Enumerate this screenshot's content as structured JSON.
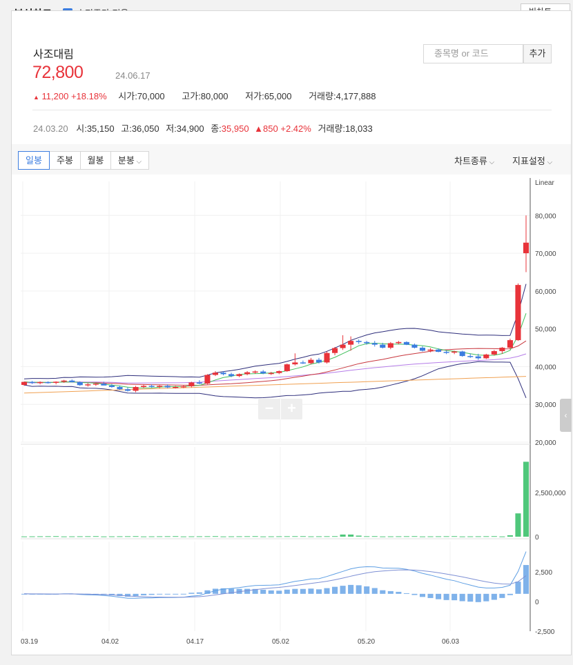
{
  "header": {
    "title": "분석차트",
    "adjusted_label": "수정주가 적용",
    "adjusted_checked": true,
    "big_chart_label": "빅차트"
  },
  "stock": {
    "name": "사조대림",
    "price": "72,800",
    "date": "24.06.17",
    "change": "11,200",
    "change_pct": "+18.18%",
    "open_label": "시가",
    "open": "70,000",
    "high_label": "고가",
    "high": "80,000",
    "low_label": "저가",
    "low": "65,000",
    "volume_label": "거래량",
    "volume": "4,177,888"
  },
  "hover": {
    "date": "24.03.20",
    "open_label": "시",
    "open": "35,150",
    "high_label": "고",
    "high": "36,050",
    "low_label": "저",
    "low": "34,900",
    "close_label": "종",
    "close": "35,950",
    "change": "850",
    "change_pct": "+2.42%",
    "volume_label": "거래량",
    "volume": "18,033"
  },
  "search": {
    "placeholder": "종목명 or 코드",
    "add_label": "추가"
  },
  "tabs": [
    {
      "label": "일봉",
      "active": true
    },
    {
      "label": "주봉",
      "active": false
    },
    {
      "label": "월봉",
      "active": false
    },
    {
      "label": "분봉",
      "active": false
    }
  ],
  "options": {
    "chart_type": "차트종류",
    "indicator": "지표설정"
  },
  "colors": {
    "up": "#e8333a",
    "down": "#3b7de0",
    "accent": "#3b7de0",
    "volume_up": "#4fc77b",
    "macd": "#7fb2ea"
  },
  "chart_data": [
    {
      "type": "candlestick",
      "scale_label": "Linear",
      "y_ticks": [
        "80,000",
        "70,000",
        "60,000",
        "50,000",
        "40,000",
        "30,000",
        "20,000"
      ],
      "ylim": [
        20000,
        89000
      ],
      "x_ticks": [
        "03.19",
        "04.02",
        "04.17",
        "05.02",
        "05.20",
        "06.03"
      ],
      "candles": [
        [
          35150,
          36050,
          34900,
          35950
        ],
        [
          35950,
          36200,
          35400,
          35700
        ],
        [
          35700,
          36100,
          35300,
          35900
        ],
        [
          35900,
          36100,
          35500,
          35700
        ],
        [
          35700,
          36100,
          35300,
          36000
        ],
        [
          36000,
          36500,
          35700,
          36300
        ],
        [
          36300,
          36600,
          35800,
          35900
        ],
        [
          35900,
          36100,
          34900,
          35100
        ],
        [
          35100,
          35600,
          34700,
          35300
        ],
        [
          35300,
          35700,
          34900,
          35500
        ],
        [
          35500,
          36000,
          35100,
          35000
        ],
        [
          35000,
          35400,
          34400,
          34600
        ],
        [
          34600,
          35000,
          33800,
          34000
        ],
        [
          34000,
          34500,
          33400,
          33600
        ],
        [
          33600,
          34900,
          33200,
          34600
        ],
        [
          34600,
          35200,
          34300,
          34900
        ],
        [
          34900,
          35300,
          34400,
          34700
        ],
        [
          34700,
          35100,
          34300,
          34900
        ],
        [
          34900,
          35300,
          34300,
          34500
        ],
        [
          34500,
          34900,
          34200,
          34600
        ],
        [
          34600,
          35100,
          34300,
          34800
        ],
        [
          34800,
          36000,
          34500,
          35800
        ],
        [
          35800,
          36400,
          35300,
          35500
        ],
        [
          35500,
          38000,
          35300,
          37800
        ],
        [
          37800,
          38800,
          37500,
          38400
        ],
        [
          38400,
          38800,
          37700,
          38000
        ],
        [
          38000,
          38400,
          37200,
          37500
        ],
        [
          37500,
          38200,
          37200,
          38000
        ],
        [
          38000,
          38800,
          37700,
          38500
        ],
        [
          38500,
          39000,
          38100,
          38700
        ],
        [
          38700,
          39100,
          38000,
          38200
        ],
        [
          38200,
          38600,
          37800,
          38300
        ],
        [
          38300,
          39000,
          38000,
          38800
        ],
        [
          38800,
          40800,
          38600,
          40600
        ],
        [
          40600,
          43500,
          40300,
          41100
        ],
        [
          41100,
          41600,
          40700,
          40900
        ],
        [
          40900,
          42300,
          40600,
          41800
        ],
        [
          41800,
          42300,
          40800,
          41100
        ],
        [
          41100,
          44000,
          40800,
          43600
        ],
        [
          43600,
          45200,
          43000,
          44900
        ],
        [
          44900,
          48300,
          44400,
          45800
        ],
        [
          45800,
          48000,
          44200,
          46800
        ],
        [
          46800,
          47200,
          46000,
          46500
        ],
        [
          46500,
          46800,
          45800,
          46200
        ],
        [
          46200,
          46800,
          45300,
          45800
        ],
        [
          45800,
          46300,
          44800,
          45000
        ],
        [
          45000,
          46500,
          44600,
          46200
        ],
        [
          46200,
          46800,
          45900,
          46500
        ],
        [
          46500,
          46700,
          45700,
          45800
        ],
        [
          45800,
          46100,
          44800,
          45000
        ],
        [
          45000,
          45400,
          44000,
          44200
        ],
        [
          44200,
          44900,
          43800,
          44500
        ],
        [
          44500,
          44800,
          43800,
          43900
        ],
        [
          43900,
          44300,
          43300,
          43700
        ],
        [
          43700,
          44200,
          43300,
          44000
        ],
        [
          44000,
          44200,
          42600,
          42800
        ],
        [
          42800,
          43400,
          42300,
          42700
        ],
        [
          42700,
          43400,
          41800,
          42200
        ],
        [
          42200,
          43400,
          42000,
          43200
        ],
        [
          43200,
          44400,
          42900,
          44100
        ],
        [
          44100,
          45200,
          43400,
          45000
        ],
        [
          45000,
          47400,
          44600,
          47000
        ],
        [
          47000,
          62000,
          46800,
          61600
        ],
        [
          70000,
          80000,
          65000,
          72800
        ]
      ],
      "overlays": [
        "이동평균",
        "볼린저밴드"
      ]
    },
    {
      "type": "bar",
      "name": "volume",
      "y_ticks": [
        "2,500,000",
        "0"
      ],
      "ylim": [
        0,
        3000000
      ]
    },
    {
      "type": "line",
      "name": "macd",
      "y_ticks": [
        "2,500",
        "0",
        "-2,500"
      ],
      "ylim": [
        -2500,
        3500
      ]
    }
  ]
}
